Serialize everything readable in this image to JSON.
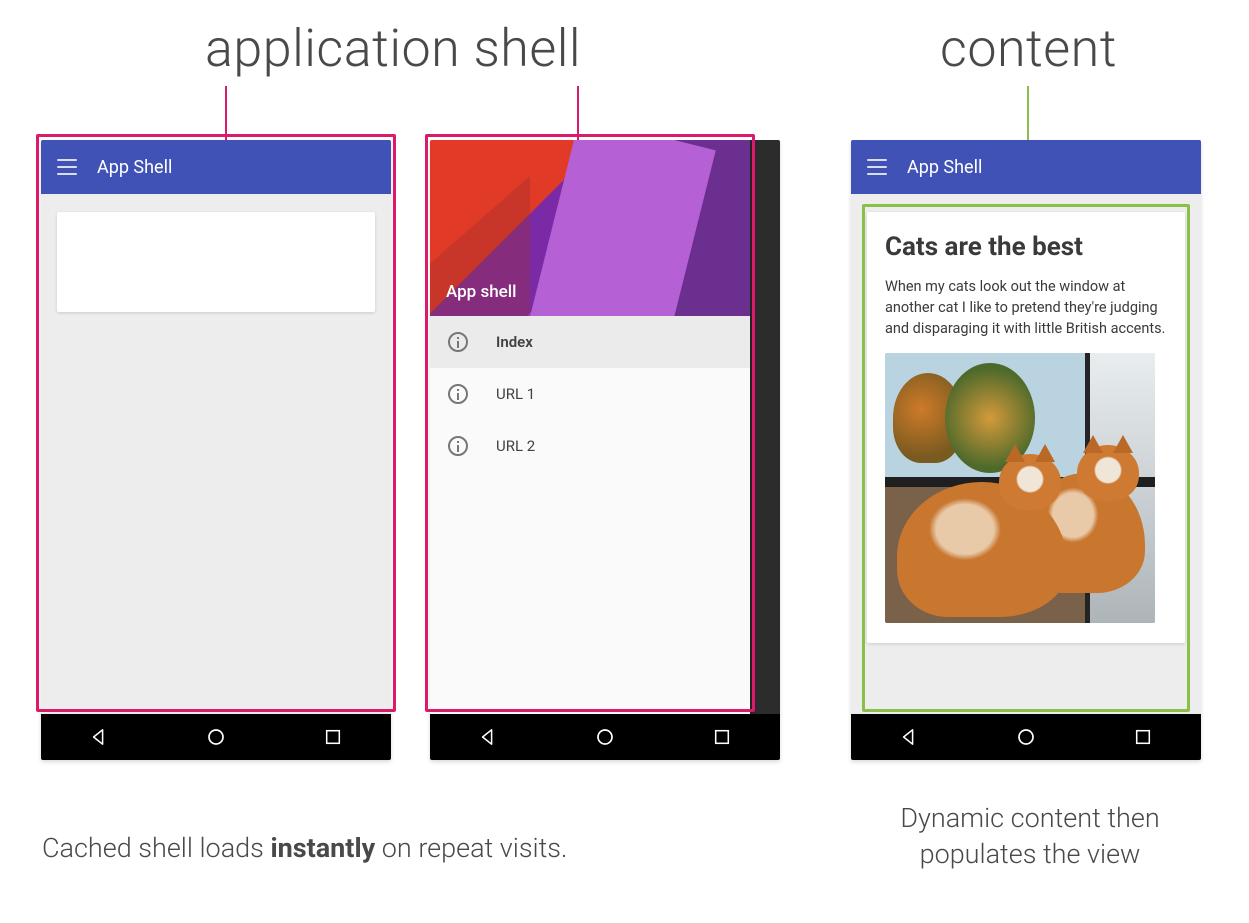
{
  "headings": {
    "app_shell": "application shell",
    "content": "content"
  },
  "phone": {
    "appbar_title": "App Shell"
  },
  "drawer": {
    "header_label": "App shell",
    "items": [
      "Index",
      "URL 1",
      "URL 2"
    ]
  },
  "content_card": {
    "title": "Cats are the best",
    "body": "When my cats look out the window at another cat I like to pretend they're judging and disparaging it with little British accents."
  },
  "captions": {
    "left_pre": "Cached shell loads ",
    "left_strong": "instantly",
    "left_post": " on repeat visits.",
    "right": "Dynamic content then populates the view"
  },
  "colors": {
    "callout_pink": "#d91b6a",
    "callout_green": "#8ac04a",
    "appbar": "#4052b5"
  }
}
